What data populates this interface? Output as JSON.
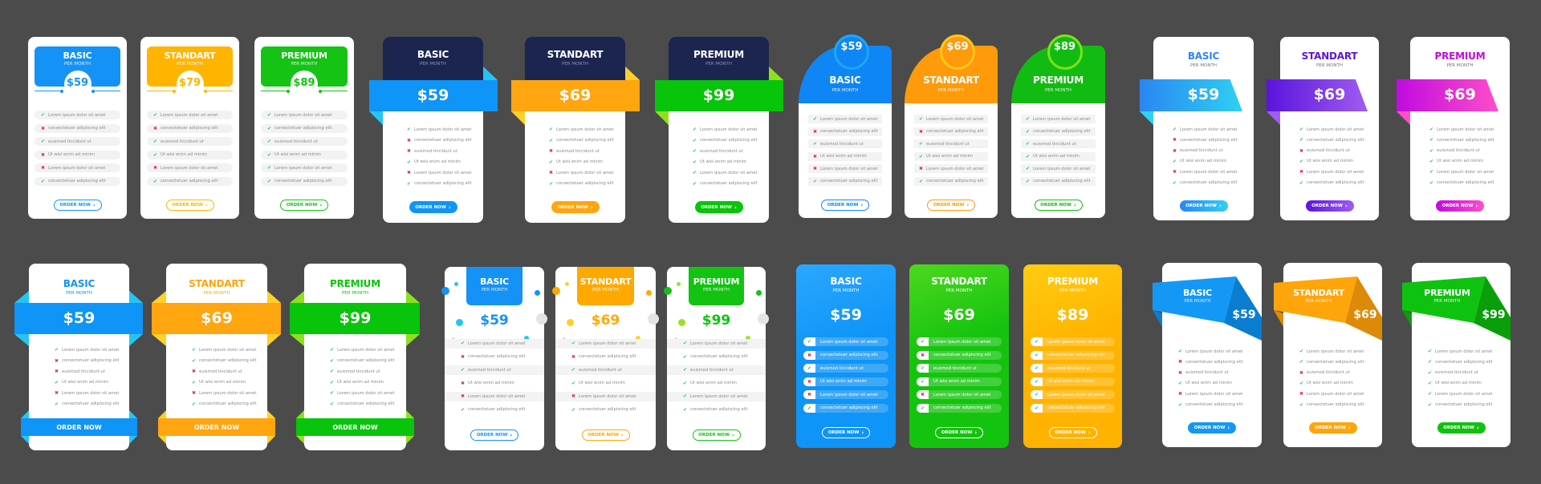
{
  "background": "#4b4b4b",
  "check_color": "#1fbf8f",
  "cross_color": "#e0245e",
  "per_month": "PER MONTH",
  "order_label": "ORDER NOW",
  "features": [
    "Lorem ipsum dolor sit amet",
    "consectetuer adipiscing elit",
    "euismod tincidunt ut",
    "Ut wisi enim ad minim",
    "Lorem ipsum dolor sit amet",
    "consectetuer adipiscing elit"
  ],
  "sets": [
    {
      "plans": [
        {
          "name": "BASIC",
          "price": "$59",
          "color": "#1592f5",
          "accent": "#1fb6ff",
          "included": [
            1,
            0,
            1,
            0,
            0,
            1
          ]
        },
        {
          "name": "STANDART",
          "price": "$79",
          "color": "#ffb400",
          "accent": "#ffd23a",
          "included": [
            1,
            0,
            1,
            1,
            0,
            1
          ]
        },
        {
          "name": "PREMIUM",
          "price": "$89",
          "color": "#14c314",
          "accent": "#8ee01e",
          "included": [
            1,
            1,
            1,
            1,
            1,
            1
          ]
        }
      ]
    },
    {
      "header_color": "#1b2550",
      "plans": [
        {
          "name": "BASIC",
          "price": "$59",
          "color": "#0f94f7",
          "accent": "#26c4f5",
          "included": [
            1,
            0,
            0,
            1,
            0,
            1
          ]
        },
        {
          "name": "STANDART",
          "price": "$69",
          "color": "#ffa510",
          "accent": "#ffd02a",
          "included": [
            1,
            1,
            0,
            1,
            0,
            1
          ]
        },
        {
          "name": "PREMIUM",
          "price": "$99",
          "color": "#08c40a",
          "accent": "#8ee01e",
          "included": [
            1,
            1,
            1,
            1,
            1,
            1
          ]
        }
      ]
    },
    {
      "plans": [
        {
          "name": "BASIC",
          "price": "$59",
          "color": "#0e86f5",
          "accent": "#1aa8ff",
          "included": [
            1,
            0,
            1,
            0,
            0,
            1
          ]
        },
        {
          "name": "STANDART",
          "price": "$69",
          "color": "#ff9a0a",
          "accent": "#ffc81a",
          "included": [
            1,
            0,
            1,
            1,
            0,
            1
          ]
        },
        {
          "name": "PREMIUM",
          "price": "$89",
          "color": "#12bb12",
          "accent": "#7fe21c",
          "included": [
            1,
            1,
            1,
            1,
            1,
            1
          ]
        }
      ]
    },
    {
      "plans": [
        {
          "name": "BASIC",
          "price": "$59",
          "color": "#2a86f2",
          "accent": "#2fd0f2",
          "included": [
            1,
            0,
            0,
            1,
            0,
            1
          ]
        },
        {
          "name": "STANDART",
          "price": "$69",
          "color": "#5a14dc",
          "accent": "#a05cf0",
          "included": [
            1,
            1,
            0,
            1,
            0,
            1
          ]
        },
        {
          "name": "PREMIUM",
          "price": "$69",
          "color": "#c00be0",
          "accent": "#ff4ec8",
          "included": [
            1,
            1,
            1,
            1,
            1,
            1
          ]
        }
      ]
    },
    {
      "plans": [
        {
          "name": "BASIC",
          "price": "$59",
          "color": "#0f94f7",
          "accent": "#26c4f5",
          "included": [
            1,
            0,
            0,
            1,
            0,
            1
          ]
        },
        {
          "name": "STANDART",
          "price": "$69",
          "color": "#ffa510",
          "accent": "#ffd02a",
          "included": [
            1,
            1,
            0,
            1,
            0,
            1
          ]
        },
        {
          "name": "PREMIUM",
          "price": "$99",
          "color": "#08c40a",
          "accent": "#8ee01e",
          "included": [
            1,
            1,
            1,
            1,
            1,
            1
          ]
        }
      ]
    },
    {
      "plans": [
        {
          "name": "BASIC",
          "price": "$59",
          "color": "#1592f5",
          "accent": "#22c6f0",
          "included": [
            1,
            0,
            1,
            0,
            0,
            1
          ]
        },
        {
          "name": "STANDART",
          "price": "$69",
          "color": "#ffa800",
          "accent": "#ffd02a",
          "included": [
            1,
            0,
            1,
            1,
            0,
            1
          ]
        },
        {
          "name": "PREMIUM",
          "price": "$99",
          "color": "#12c312",
          "accent": "#9be22a",
          "included": [
            1,
            1,
            1,
            1,
            1,
            1
          ]
        }
      ]
    },
    {
      "plans": [
        {
          "name": "BASIC",
          "price": "$59",
          "color": "#0f94f7",
          "accent": "#2aa8ff",
          "included": [
            1,
            0,
            1,
            0,
            0,
            1
          ]
        },
        {
          "name": "STANDART",
          "price": "$69",
          "color": "#14c30e",
          "accent": "#4cd81e",
          "included": [
            1,
            0,
            1,
            1,
            0,
            1
          ]
        },
        {
          "name": "PREMIUM",
          "price": "$89",
          "color": "#ffb300",
          "accent": "#ffcc10",
          "included": [
            1,
            1,
            1,
            1,
            1,
            1
          ]
        }
      ]
    },
    {
      "plans": [
        {
          "name": "BASIC",
          "price": "$59",
          "color": "#1498f5",
          "accent": "#0b7dd0",
          "included": [
            1,
            0,
            0,
            1,
            0,
            1
          ]
        },
        {
          "name": "STANDART",
          "price": "$69",
          "color": "#ffa50c",
          "accent": "#dd8a08",
          "included": [
            1,
            1,
            0,
            1,
            0,
            1
          ]
        },
        {
          "name": "PREMIUM",
          "price": "$99",
          "color": "#10c210",
          "accent": "#0a9e0a",
          "included": [
            1,
            1,
            1,
            1,
            1,
            1
          ]
        }
      ]
    }
  ]
}
